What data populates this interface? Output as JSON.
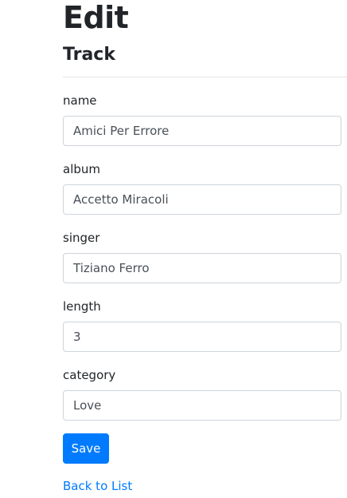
{
  "page": {
    "title": "Edit",
    "subtitle": "Track"
  },
  "form": {
    "fields": [
      {
        "label": "name",
        "value": "Amici Per Errore"
      },
      {
        "label": "album",
        "value": "Accetto Miracoli"
      },
      {
        "label": "singer",
        "value": "Tiziano Ferro"
      },
      {
        "label": "length",
        "value": "3"
      },
      {
        "label": "category",
        "value": "Love"
      }
    ],
    "save_label": "Save"
  },
  "links": {
    "back_label": "Back to List"
  },
  "colors": {
    "primary": "#007bff",
    "border": "#ced4da",
    "text": "#212529"
  }
}
